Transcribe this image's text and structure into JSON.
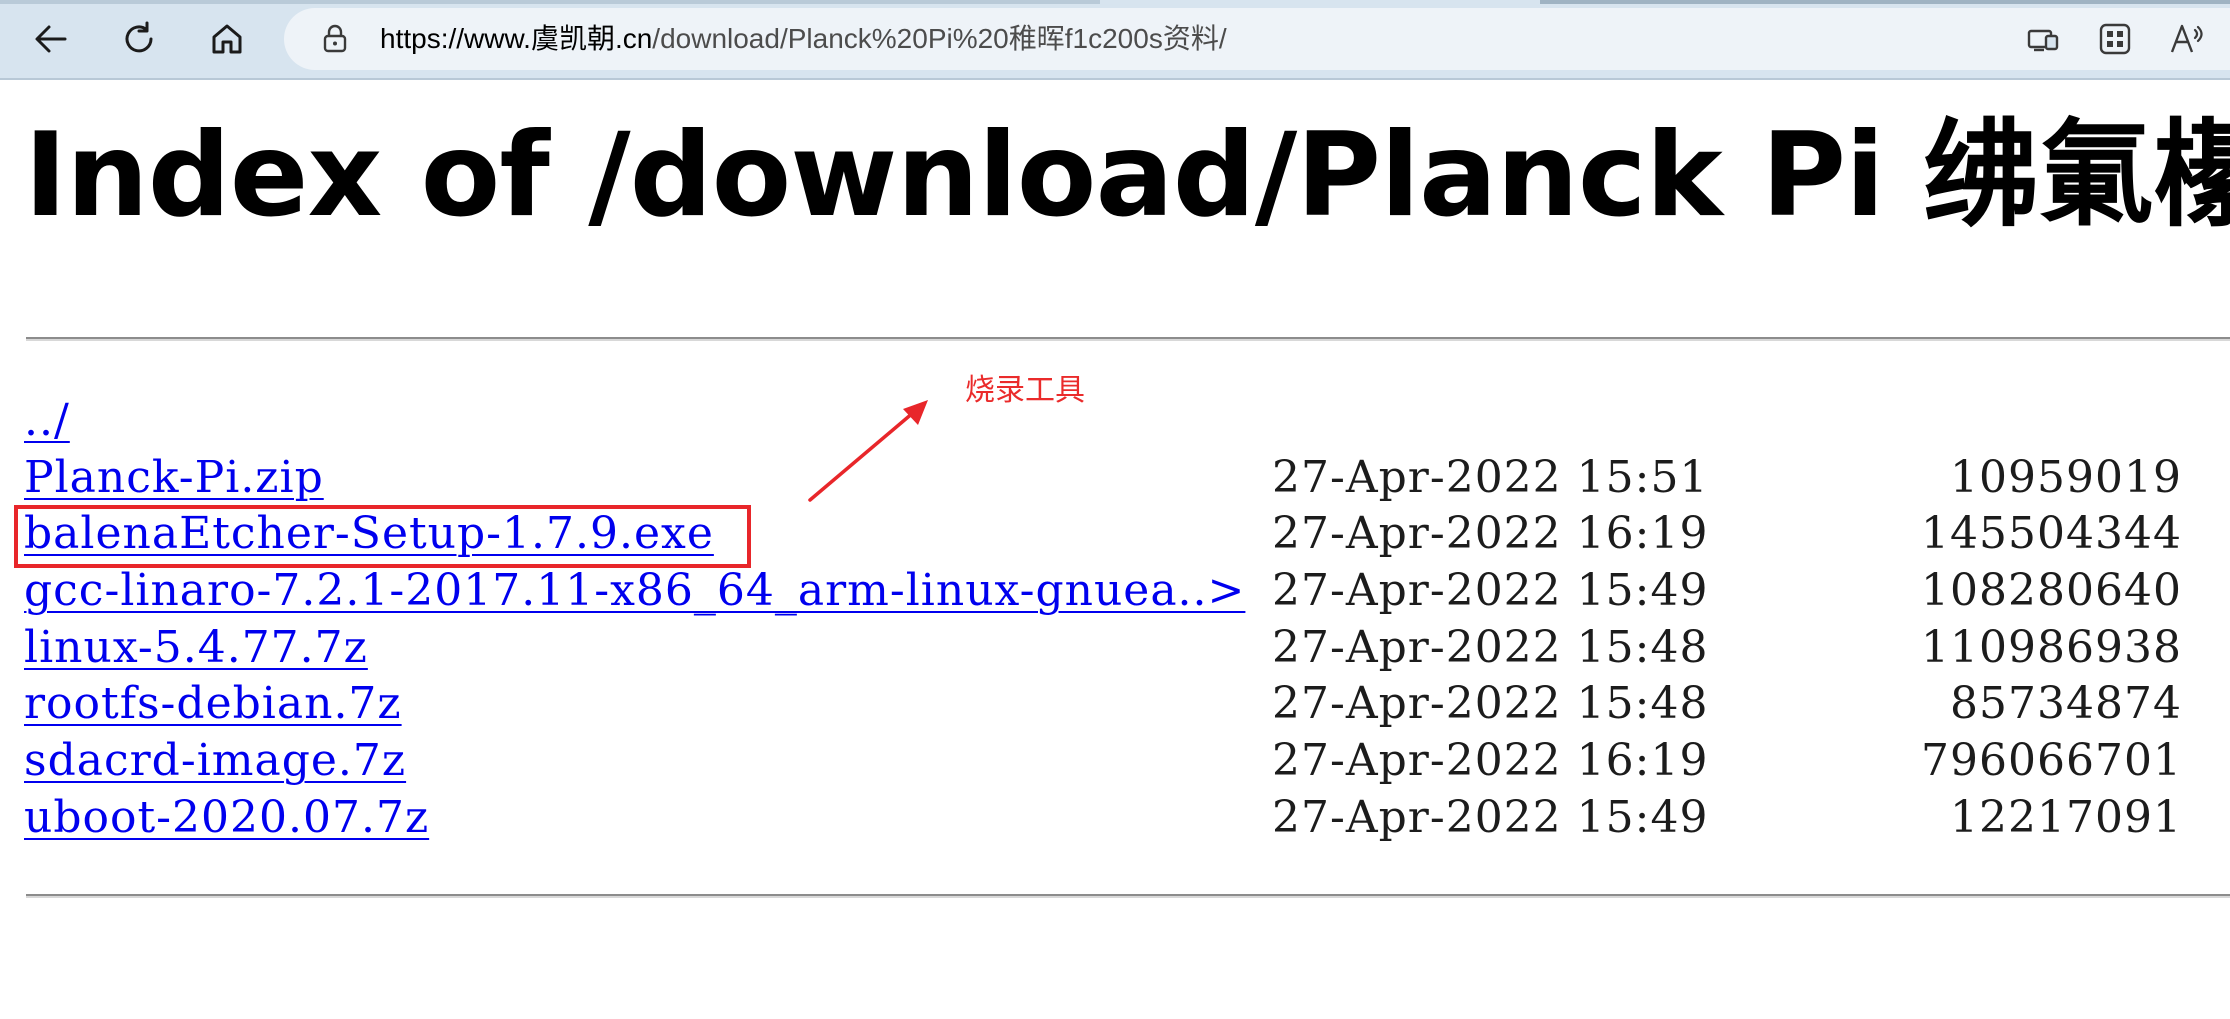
{
  "browser": {
    "url_host": "https://www.虞凯朝.cn",
    "url_path": "/download/Planck%20Pi%20稚晖f1c200s资料/",
    "icons": [
      "back-arrow-icon",
      "reload-icon",
      "home-icon",
      "lock-icon",
      "app-available-icon",
      "extensions-icon",
      "read-aloud-icon"
    ]
  },
  "page": {
    "title": "Index of /download/Planck Pi 绋氭櫀"
  },
  "listing": {
    "parent": "../",
    "rows": [
      {
        "name": "Planck-Pi.zip",
        "date": "27-Apr-2022 15:51",
        "size": "10959019"
      },
      {
        "name": "balenaEtcher-Setup-1.7.9.exe",
        "date": "27-Apr-2022 16:19",
        "size": "145504344"
      },
      {
        "name": "gcc-linaro-7.2.1-2017.11-x86_64_arm-linux-gnuea..>",
        "date": "27-Apr-2022 15:49",
        "size": "108280640"
      },
      {
        "name": "linux-5.4.77.7z",
        "date": "27-Apr-2022 15:48",
        "size": "110986938"
      },
      {
        "name": "rootfs-debian.7z",
        "date": "27-Apr-2022 15:48",
        "size": "85734874"
      },
      {
        "name": "sdacrd-image.7z",
        "date": "27-Apr-2022 16:19",
        "size": "796066701"
      },
      {
        "name": "uboot-2020.07.7z",
        "date": "27-Apr-2022 15:49",
        "size": "12217091"
      }
    ]
  },
  "annotation": {
    "label": "烧录工具",
    "color": "#e8262a"
  },
  "colors": {
    "toolbar_bg": "#d7e4ef",
    "link": "#0000ee"
  }
}
